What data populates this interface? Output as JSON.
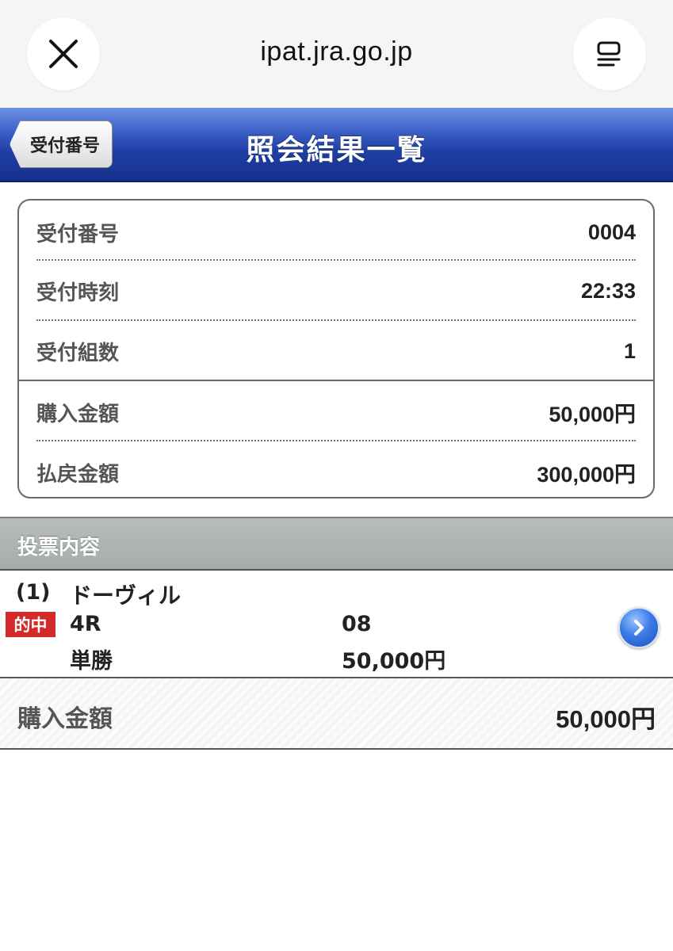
{
  "browser": {
    "url": "ipat.jra.go.jp",
    "close_icon": "close-icon",
    "menu_icon": "tab-menu-icon"
  },
  "header": {
    "back_label": "受付番号",
    "title": "照会結果一覧",
    "colors": {
      "bar": "#1f3fa5",
      "title_text": "#ffffff"
    }
  },
  "summary": {
    "rows": [
      {
        "label": "受付番号",
        "value": "0004"
      },
      {
        "label": "受付時刻",
        "value": "22:33"
      },
      {
        "label": "受付組数",
        "value": "1"
      },
      {
        "label": "購入金額",
        "value": "50,000円"
      },
      {
        "label": "払戻金額",
        "value": "300,000円"
      }
    ]
  },
  "bets": {
    "section_title": "投票内容",
    "items": [
      {
        "index": "(1)",
        "venue": "ドーヴィル",
        "result_badge": "的中",
        "race": "4R",
        "selection": "08",
        "bet_type": "単勝",
        "amount": "50,000円",
        "badge_color": "#d42a2a"
      }
    ]
  },
  "total": {
    "label": "購入金額",
    "value": "50,000円"
  }
}
